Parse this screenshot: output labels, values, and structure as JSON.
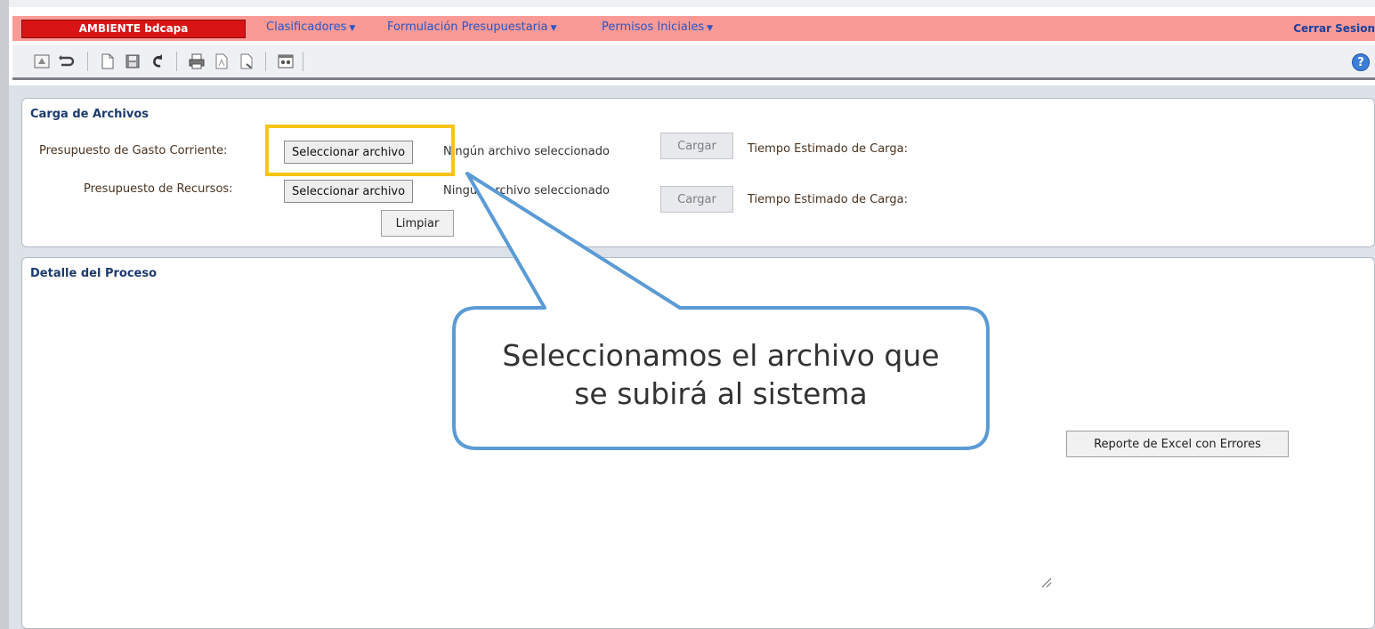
{
  "header": {
    "environment": "AMBIENTE bdcapa",
    "menus": [
      {
        "label": "Clasificadores"
      },
      {
        "label": "Formulación Presupuestaria"
      },
      {
        "label": "Permisos Iniciales"
      }
    ],
    "logout": "Cerrar Sesion"
  },
  "toolbar": {
    "icons": [
      "home-icon",
      "undo-icon",
      "new-document-icon",
      "save-icon",
      "redo-icon",
      "print-icon",
      "export-pdf-icon",
      "export-icon",
      "preview-icon"
    ],
    "help": "?"
  },
  "upload_panel": {
    "title": "Carga de Archivos",
    "rows": [
      {
        "label": "Presupuesto de Gasto Corriente:",
        "file_button": "Seleccionar archivo",
        "file_status": "Ningún archivo seleccionado",
        "load_button": "Cargar",
        "estimate_label": "Tiempo Estimado de Carga:"
      },
      {
        "label": "Presupuesto de Recursos:",
        "file_button": "Seleccionar archivo",
        "file_status": "Ningún archivo seleccionado",
        "load_button": "Cargar",
        "estimate_label": "Tiempo Estimado de Carga:"
      }
    ],
    "clear_button": "Limpiar"
  },
  "detail_panel": {
    "title": "Detalle del Proceso",
    "excel_button": "Reporte de Excel con Errores"
  },
  "callout": {
    "line1": "Seleccionamos el archivo que",
    "line2": "se subirá al sistema"
  },
  "colors": {
    "menubar": "#fa9a96",
    "env_badge": "#d81414",
    "menu_link": "#2b55c4",
    "highlight": "#f6c416",
    "callout_border": "#5b9bd5"
  }
}
